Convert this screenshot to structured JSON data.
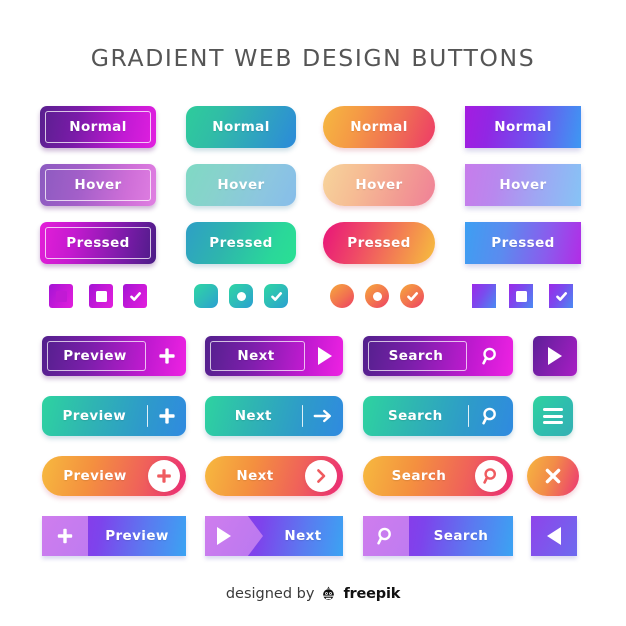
{
  "page": {
    "title": "GRADIENT WEB DESIGN BUTTONS",
    "background": "#ffffff"
  },
  "states": {
    "normal": "Normal",
    "hover": "Hover",
    "pressed": "Pressed"
  },
  "styles": [
    {
      "id": "purple-outline",
      "name": "Purple Outlined Rectangle",
      "shape": "rounded-rect",
      "accent": "#c21ad4",
      "gradient_from": "#59208f",
      "gradient_to": "#e21fe0",
      "buttons": [
        {
          "state_key": "normal",
          "label": "Normal"
        },
        {
          "state_key": "hover",
          "label": "Hover"
        },
        {
          "state_key": "pressed",
          "label": "Pressed"
        }
      ]
    },
    {
      "id": "teal-blue",
      "name": "Teal to Blue Rounded",
      "shape": "rounded-rect",
      "accent": "#2ecc9b",
      "gradient_from": "#2ecc9b",
      "gradient_to": "#2b8ada",
      "buttons": [
        {
          "state_key": "normal",
          "label": "Normal"
        },
        {
          "state_key": "hover",
          "label": "Hover"
        },
        {
          "state_key": "pressed",
          "label": "Pressed"
        }
      ]
    },
    {
      "id": "orange-pink",
      "name": "Orange to Pink Pill",
      "shape": "pill",
      "accent": "#ef6a55",
      "gradient_from": "#f5b841",
      "gradient_to": "#ee3a68",
      "buttons": [
        {
          "state_key": "normal",
          "label": "Normal"
        },
        {
          "state_key": "hover",
          "label": "Hover"
        },
        {
          "state_key": "pressed",
          "label": "Pressed"
        }
      ]
    },
    {
      "id": "violet-blue",
      "name": "Violet to Blue Square",
      "shape": "square",
      "accent": "#6f52ef",
      "gradient_from": "#a41ce0",
      "gradient_to": "#3d98f2",
      "buttons": [
        {
          "state_key": "normal",
          "label": "Normal"
        },
        {
          "state_key": "hover",
          "label": "Hover"
        },
        {
          "state_key": "pressed",
          "label": "Pressed"
        }
      ]
    }
  ],
  "checkboxes": [
    {
      "set": "purple-outline",
      "items": [
        {
          "icon": "checkbox-filled-square-icon",
          "state": "selected"
        },
        {
          "icon": "checkbox-empty-square-icon",
          "state": "unselected"
        },
        {
          "icon": "checkbox-check-icon",
          "state": "checked"
        }
      ]
    },
    {
      "set": "teal-blue",
      "items": [
        {
          "icon": "checkbox-rounded-filled-icon",
          "state": "selected"
        },
        {
          "icon": "radio-dot-icon",
          "state": "unselected"
        },
        {
          "icon": "checkbox-check-icon",
          "state": "checked"
        }
      ]
    },
    {
      "set": "orange-pink",
      "items": [
        {
          "icon": "radio-filled-circle-icon",
          "state": "selected"
        },
        {
          "icon": "radio-dot-icon",
          "state": "unselected"
        },
        {
          "icon": "radio-check-icon",
          "state": "checked"
        }
      ]
    },
    {
      "set": "violet-blue",
      "items": [
        {
          "icon": "checkbox-filled-square-icon",
          "state": "selected"
        },
        {
          "icon": "checkbox-square-dot-icon",
          "state": "unselected"
        },
        {
          "icon": "checkbox-check-icon",
          "state": "checked"
        }
      ]
    }
  ],
  "actions": {
    "rows": [
      {
        "id": "row-purple",
        "style": "purple-outline",
        "buttons": [
          {
            "label": "Preview",
            "icon": "plus-icon"
          },
          {
            "label": "Next",
            "icon": "play-triangle-icon"
          },
          {
            "label": "Search",
            "icon": "search-icon"
          },
          {
            "label": "",
            "icon": "play-triangle-icon"
          }
        ]
      },
      {
        "id": "row-teal",
        "style": "teal-blue",
        "buttons": [
          {
            "label": "Preview",
            "icon": "plus-icon"
          },
          {
            "label": "Next",
            "icon": "arrow-right-icon"
          },
          {
            "label": "Search",
            "icon": "search-icon"
          },
          {
            "label": "",
            "icon": "hamburger-menu-icon"
          }
        ]
      },
      {
        "id": "row-orange",
        "style": "orange-pink",
        "buttons": [
          {
            "label": "Preview",
            "icon": "plus-circle-icon"
          },
          {
            "label": "Next",
            "icon": "chevron-right-circle-icon"
          },
          {
            "label": "Search",
            "icon": "search-circle-icon"
          },
          {
            "label": "",
            "icon": "close-x-icon"
          }
        ]
      },
      {
        "id": "row-violet",
        "style": "violet-blue",
        "buttons": [
          {
            "label": "Preview",
            "icon": "plus-icon"
          },
          {
            "label": "Next",
            "icon": "play-triangle-icon"
          },
          {
            "label": "Search",
            "icon": "search-icon"
          },
          {
            "label": "",
            "icon": "play-triangle-left-icon"
          }
        ]
      }
    ]
  },
  "footer": {
    "designed_by": "designed by",
    "brand": "freepik",
    "logo_icon": "freepik-logo-icon"
  }
}
